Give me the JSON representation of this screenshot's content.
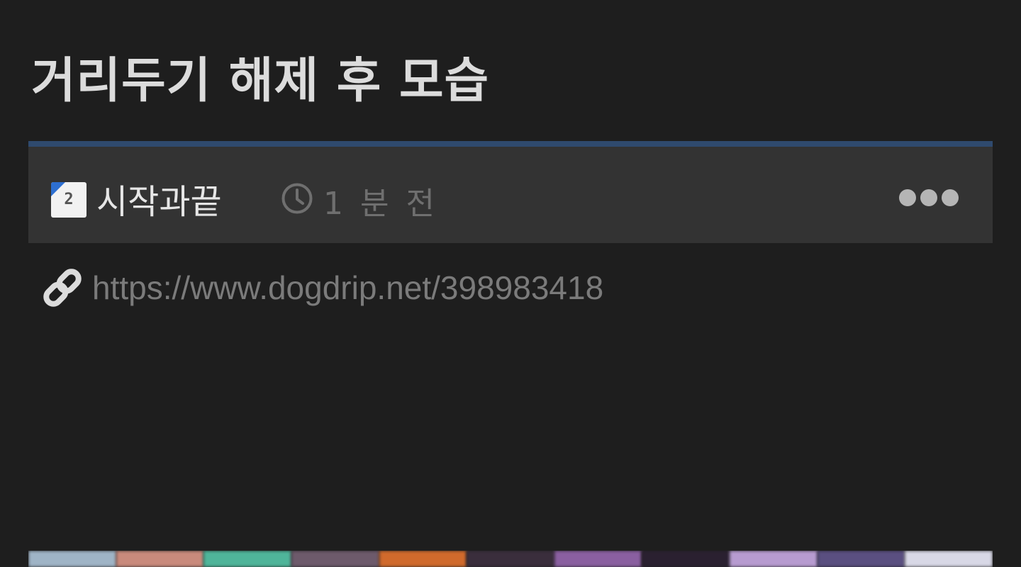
{
  "post": {
    "title": "거리두기 해제 후 모습",
    "author": {
      "level": "2",
      "name": "시작과끝"
    },
    "time_ago": "1 분 전",
    "url": "https://www.dogdrip.net/398983418"
  },
  "colors": {
    "background": "#1e1e1e",
    "meta_bar": "#333333",
    "accent_border": "#2f4a6e",
    "title_text": "#dcdcdc",
    "muted_text": "#6f6f6f"
  },
  "icons": {
    "level_badge": "level-badge-icon",
    "time": "clock-icon",
    "more": "more-dots-icon",
    "link": "link-icon"
  }
}
